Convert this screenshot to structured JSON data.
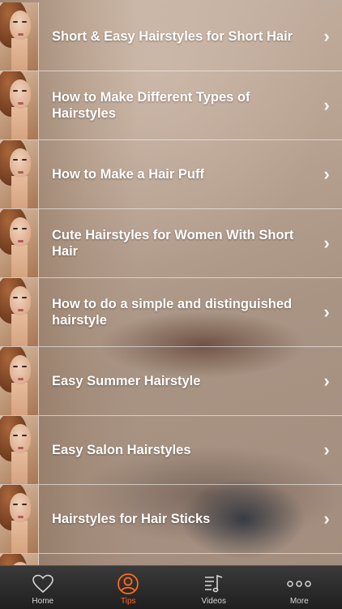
{
  "list": {
    "items": [
      {
        "title": "Short & Easy Hairstyles for Short Hair"
      },
      {
        "title": "How to Make Different Types of Hairstyles"
      },
      {
        "title": "How to Make a Hair Puff"
      },
      {
        "title": "Cute Hairstyles for Women With Short Hair"
      },
      {
        "title": "How to do a simple and distinguished hairstyle"
      },
      {
        "title": "Easy Summer Hairstyle"
      },
      {
        "title": "Easy Salon Hairstyles"
      },
      {
        "title": "Hairstyles for Hair Sticks"
      }
    ],
    "chevron": "›"
  },
  "tabbar": {
    "tabs": [
      {
        "label": "Home",
        "icon": "heart-icon"
      },
      {
        "label": "Tips",
        "icon": "person-icon",
        "active": true
      },
      {
        "label": "Videos",
        "icon": "music-list-icon"
      },
      {
        "label": "More",
        "icon": "more-dots-icon"
      }
    ],
    "active_color": "#ff6a1a",
    "inactive_color": "#d8d8d8"
  }
}
